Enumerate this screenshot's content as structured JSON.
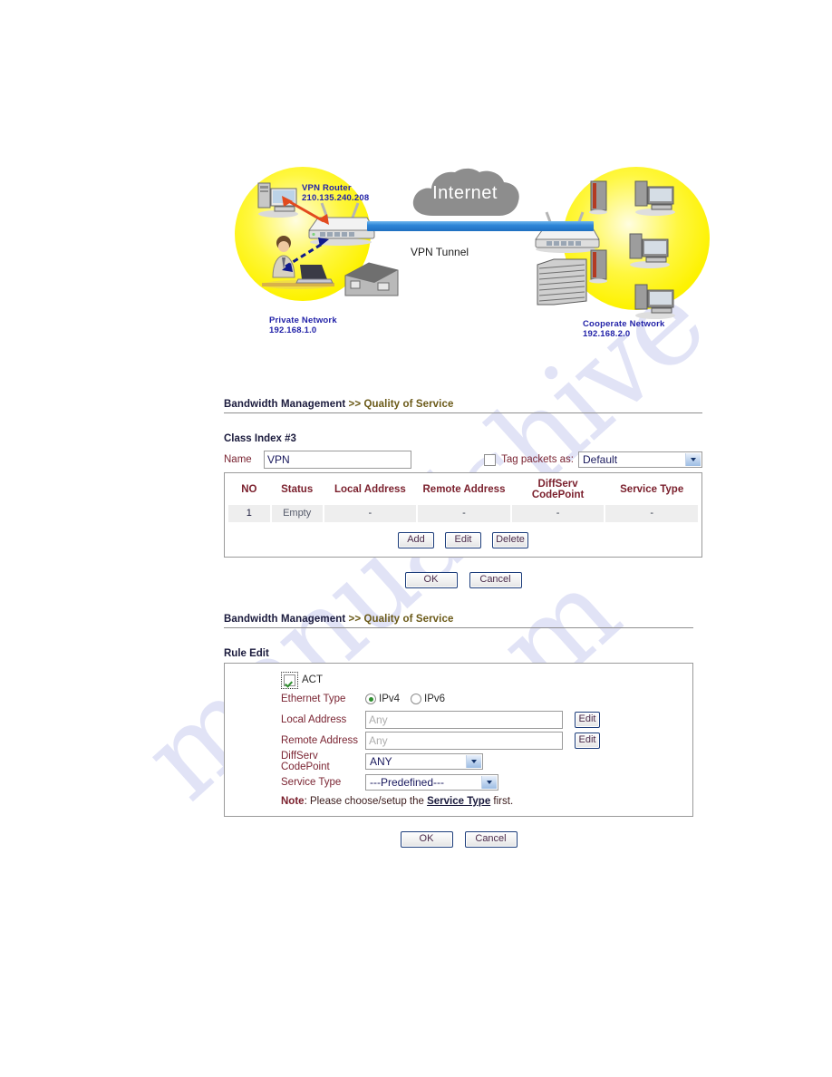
{
  "diagram": {
    "vpn_router_label": "VPN Router",
    "vpn_router_ip": "210.135.240.208",
    "internet_label": "Internet",
    "tunnel_label": "VPN Tunnel",
    "private_network_label": "Private Network",
    "private_network_ip": "192.168.1.0",
    "cooperate_network_label": "Cooperate Network",
    "cooperate_network_ip": "192.168.2.0"
  },
  "watermark": {
    "line1": "manualshive",
    "line2": ".com"
  },
  "section1": {
    "breadcrumb_primary": "Bandwidth Management",
    "breadcrumb_separator": " >> ",
    "breadcrumb_secondary": "Quality of Service",
    "class_index": "Class Index #3",
    "name_label": "Name",
    "name_value": "VPN",
    "tag_packets_label": "Tag packets as:",
    "tag_packets_checked": false,
    "tag_packets_value": "Default",
    "table": {
      "headers": [
        "NO",
        "Status",
        "Local Address",
        "Remote Address",
        "DiffServ CodePoint",
        "Service Type"
      ],
      "header_diffserv_line1": "DiffServ",
      "header_diffserv_line2": "CodePoint",
      "rows": [
        {
          "no": "1",
          "status": "Empty",
          "local": "-",
          "remote": "-",
          "diffserv": "-",
          "service": "-"
        }
      ]
    },
    "buttons": {
      "add": "Add",
      "edit": "Edit",
      "delete": "Delete"
    },
    "footer_buttons": {
      "ok": "OK",
      "cancel": "Cancel"
    }
  },
  "section2": {
    "breadcrumb_primary": "Bandwidth Management",
    "breadcrumb_separator": " >> ",
    "breadcrumb_secondary": "Quality of Service",
    "title": "Rule Edit",
    "act_label": "ACT",
    "act_checked": true,
    "ethernet_type_label": "Ethernet Type",
    "ipv4_label": "IPv4",
    "ipv6_label": "IPv6",
    "ethernet_type_selected": "IPv4",
    "local_address_label": "Local Address",
    "local_address_value": "",
    "local_address_placeholder": "Any",
    "local_address_edit": "Edit",
    "remote_address_label": "Remote Address",
    "remote_address_value": "",
    "remote_address_placeholder": "Any",
    "remote_address_edit": "Edit",
    "diffserv_label": "DiffServ CodePoint",
    "diffserv_value": "ANY",
    "service_type_label": "Service Type",
    "service_type_value": "---Predefined---",
    "note_prefix": "Note",
    "note_text_1": ": Please choose/setup the ",
    "note_link": "Service Type",
    "note_text_2": " first.",
    "footer_buttons": {
      "ok": "OK",
      "cancel": "Cancel"
    }
  }
}
